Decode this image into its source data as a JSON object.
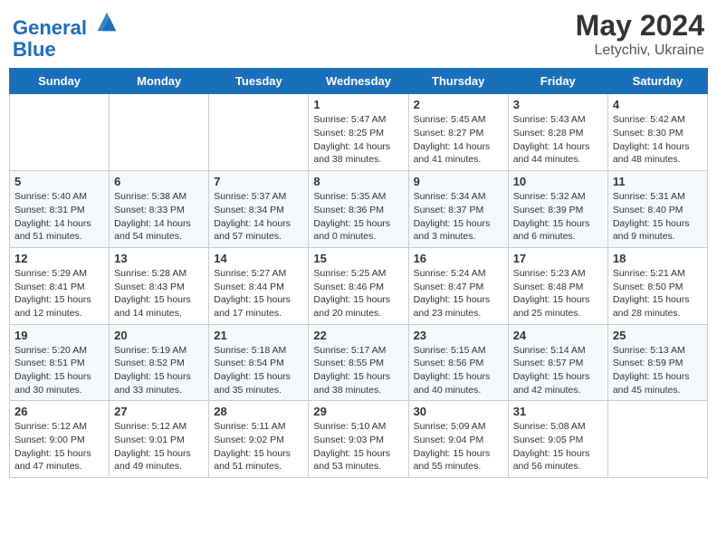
{
  "header": {
    "logo_line1": "General",
    "logo_line2": "Blue",
    "main_title": "May 2024",
    "sub_title": "Letychiv, Ukraine"
  },
  "days_of_week": [
    "Sunday",
    "Monday",
    "Tuesday",
    "Wednesday",
    "Thursday",
    "Friday",
    "Saturday"
  ],
  "weeks": [
    [
      {
        "day": "",
        "info": ""
      },
      {
        "day": "",
        "info": ""
      },
      {
        "day": "",
        "info": ""
      },
      {
        "day": "1",
        "info": "Sunrise: 5:47 AM\nSunset: 8:25 PM\nDaylight: 14 hours\nand 38 minutes."
      },
      {
        "day": "2",
        "info": "Sunrise: 5:45 AM\nSunset: 8:27 PM\nDaylight: 14 hours\nand 41 minutes."
      },
      {
        "day": "3",
        "info": "Sunrise: 5:43 AM\nSunset: 8:28 PM\nDaylight: 14 hours\nand 44 minutes."
      },
      {
        "day": "4",
        "info": "Sunrise: 5:42 AM\nSunset: 8:30 PM\nDaylight: 14 hours\nand 48 minutes."
      }
    ],
    [
      {
        "day": "5",
        "info": "Sunrise: 5:40 AM\nSunset: 8:31 PM\nDaylight: 14 hours\nand 51 minutes."
      },
      {
        "day": "6",
        "info": "Sunrise: 5:38 AM\nSunset: 8:33 PM\nDaylight: 14 hours\nand 54 minutes."
      },
      {
        "day": "7",
        "info": "Sunrise: 5:37 AM\nSunset: 8:34 PM\nDaylight: 14 hours\nand 57 minutes."
      },
      {
        "day": "8",
        "info": "Sunrise: 5:35 AM\nSunset: 8:36 PM\nDaylight: 15 hours\nand 0 minutes."
      },
      {
        "day": "9",
        "info": "Sunrise: 5:34 AM\nSunset: 8:37 PM\nDaylight: 15 hours\nand 3 minutes."
      },
      {
        "day": "10",
        "info": "Sunrise: 5:32 AM\nSunset: 8:39 PM\nDaylight: 15 hours\nand 6 minutes."
      },
      {
        "day": "11",
        "info": "Sunrise: 5:31 AM\nSunset: 8:40 PM\nDaylight: 15 hours\nand 9 minutes."
      }
    ],
    [
      {
        "day": "12",
        "info": "Sunrise: 5:29 AM\nSunset: 8:41 PM\nDaylight: 15 hours\nand 12 minutes."
      },
      {
        "day": "13",
        "info": "Sunrise: 5:28 AM\nSunset: 8:43 PM\nDaylight: 15 hours\nand 14 minutes."
      },
      {
        "day": "14",
        "info": "Sunrise: 5:27 AM\nSunset: 8:44 PM\nDaylight: 15 hours\nand 17 minutes."
      },
      {
        "day": "15",
        "info": "Sunrise: 5:25 AM\nSunset: 8:46 PM\nDaylight: 15 hours\nand 20 minutes."
      },
      {
        "day": "16",
        "info": "Sunrise: 5:24 AM\nSunset: 8:47 PM\nDaylight: 15 hours\nand 23 minutes."
      },
      {
        "day": "17",
        "info": "Sunrise: 5:23 AM\nSunset: 8:48 PM\nDaylight: 15 hours\nand 25 minutes."
      },
      {
        "day": "18",
        "info": "Sunrise: 5:21 AM\nSunset: 8:50 PM\nDaylight: 15 hours\nand 28 minutes."
      }
    ],
    [
      {
        "day": "19",
        "info": "Sunrise: 5:20 AM\nSunset: 8:51 PM\nDaylight: 15 hours\nand 30 minutes."
      },
      {
        "day": "20",
        "info": "Sunrise: 5:19 AM\nSunset: 8:52 PM\nDaylight: 15 hours\nand 33 minutes."
      },
      {
        "day": "21",
        "info": "Sunrise: 5:18 AM\nSunset: 8:54 PM\nDaylight: 15 hours\nand 35 minutes."
      },
      {
        "day": "22",
        "info": "Sunrise: 5:17 AM\nSunset: 8:55 PM\nDaylight: 15 hours\nand 38 minutes."
      },
      {
        "day": "23",
        "info": "Sunrise: 5:15 AM\nSunset: 8:56 PM\nDaylight: 15 hours\nand 40 minutes."
      },
      {
        "day": "24",
        "info": "Sunrise: 5:14 AM\nSunset: 8:57 PM\nDaylight: 15 hours\nand 42 minutes."
      },
      {
        "day": "25",
        "info": "Sunrise: 5:13 AM\nSunset: 8:59 PM\nDaylight: 15 hours\nand 45 minutes."
      }
    ],
    [
      {
        "day": "26",
        "info": "Sunrise: 5:12 AM\nSunset: 9:00 PM\nDaylight: 15 hours\nand 47 minutes."
      },
      {
        "day": "27",
        "info": "Sunrise: 5:12 AM\nSunset: 9:01 PM\nDaylight: 15 hours\nand 49 minutes."
      },
      {
        "day": "28",
        "info": "Sunrise: 5:11 AM\nSunset: 9:02 PM\nDaylight: 15 hours\nand 51 minutes."
      },
      {
        "day": "29",
        "info": "Sunrise: 5:10 AM\nSunset: 9:03 PM\nDaylight: 15 hours\nand 53 minutes."
      },
      {
        "day": "30",
        "info": "Sunrise: 5:09 AM\nSunset: 9:04 PM\nDaylight: 15 hours\nand 55 minutes."
      },
      {
        "day": "31",
        "info": "Sunrise: 5:08 AM\nSunset: 9:05 PM\nDaylight: 15 hours\nand 56 minutes."
      },
      {
        "day": "",
        "info": ""
      }
    ]
  ]
}
